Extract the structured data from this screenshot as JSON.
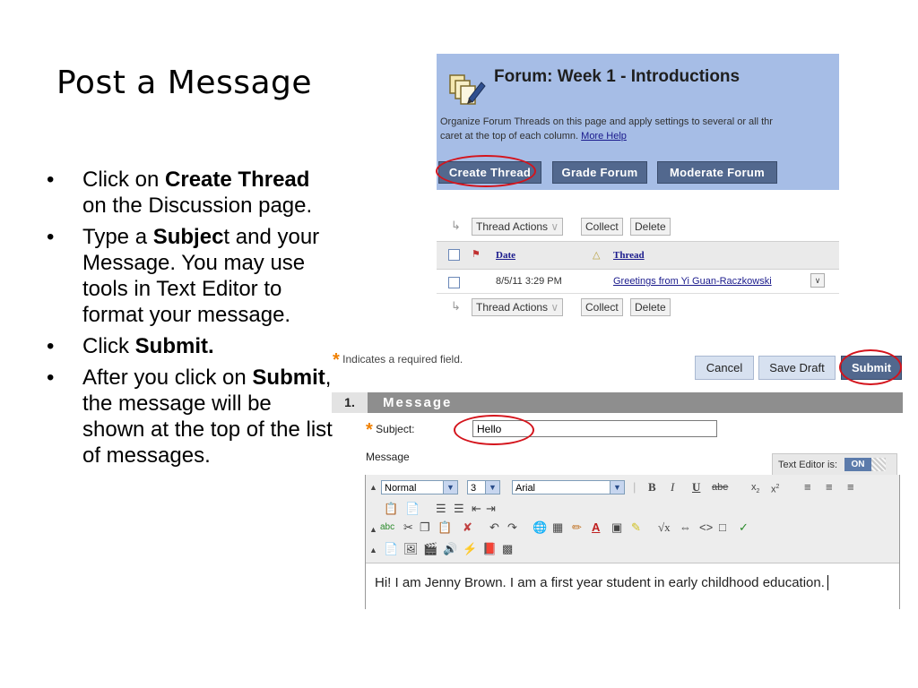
{
  "slide": {
    "title": "Post a Message",
    "bullets": [
      {
        "parts": [
          {
            "text": "Click on ",
            "bold": false
          },
          {
            "text": "Create Thread",
            "bold": true
          },
          {
            "text": " on the Discussion page.",
            "bold": false
          }
        ]
      },
      {
        "parts": [
          {
            "text": "Type a ",
            "bold": false
          },
          {
            "text": "Subjec",
            "bold": true
          },
          {
            "text": "t and your Message. You may use tools in Text Editor to format your message.",
            "bold": false
          }
        ]
      },
      {
        "parts": [
          {
            "text": "Click ",
            "bold": false
          },
          {
            "text": "Submit.",
            "bold": true
          }
        ]
      },
      {
        "parts": [
          {
            "text": "After you click on ",
            "bold": false
          },
          {
            "text": "Submit",
            "bold": true
          },
          {
            "text": ", the message will be shown at the top of the list of messages.",
            "bold": false
          }
        ]
      }
    ]
  },
  "forum": {
    "title": "Forum: Week 1 - Introductions",
    "desc_line1": "Organize Forum Threads on this page and apply settings to several or all thr",
    "desc_line2": "caret at the top of each column. ",
    "more_help": "More Help",
    "buttons": {
      "create_thread": "Create Thread",
      "grade_forum": "Grade Forum",
      "moderate_forum": "Moderate Forum"
    }
  },
  "thread_table": {
    "top_actions": {
      "thread_actions": "Thread Actions",
      "collect": "Collect",
      "delete": "Delete"
    },
    "headers": {
      "date": "Date",
      "thread": "Thread"
    },
    "rows": [
      {
        "date": "8/5/11 3:29 PM",
        "thread": "Greetings from Yi Guan-Raczkowski"
      }
    ],
    "bottom_actions": {
      "thread_actions": "Thread Actions",
      "collect": "Collect",
      "delete": "Delete"
    }
  },
  "form": {
    "required_note": "Indicates a required field.",
    "buttons": {
      "cancel": "Cancel",
      "save_draft": "Save Draft",
      "submit": "Submit"
    },
    "section_number": "1.",
    "section_title": "Message",
    "subject_label": "Subject:",
    "subject_value": "Hello",
    "message_label": "Message",
    "text_editor_label": "Text Editor is:",
    "text_editor_state": "ON"
  },
  "editor": {
    "format": "Normal",
    "size": "3",
    "font": "Arial",
    "content": "Hi! I am Jenny Brown.  I am a first year student in early childhood education."
  },
  "colors": {
    "highlight_ring": "#d4141c",
    "required_star": "#f08000",
    "forum_bg": "#a6bde6",
    "forum_button": "#52688e",
    "section_bar": "#8e8e8e"
  }
}
